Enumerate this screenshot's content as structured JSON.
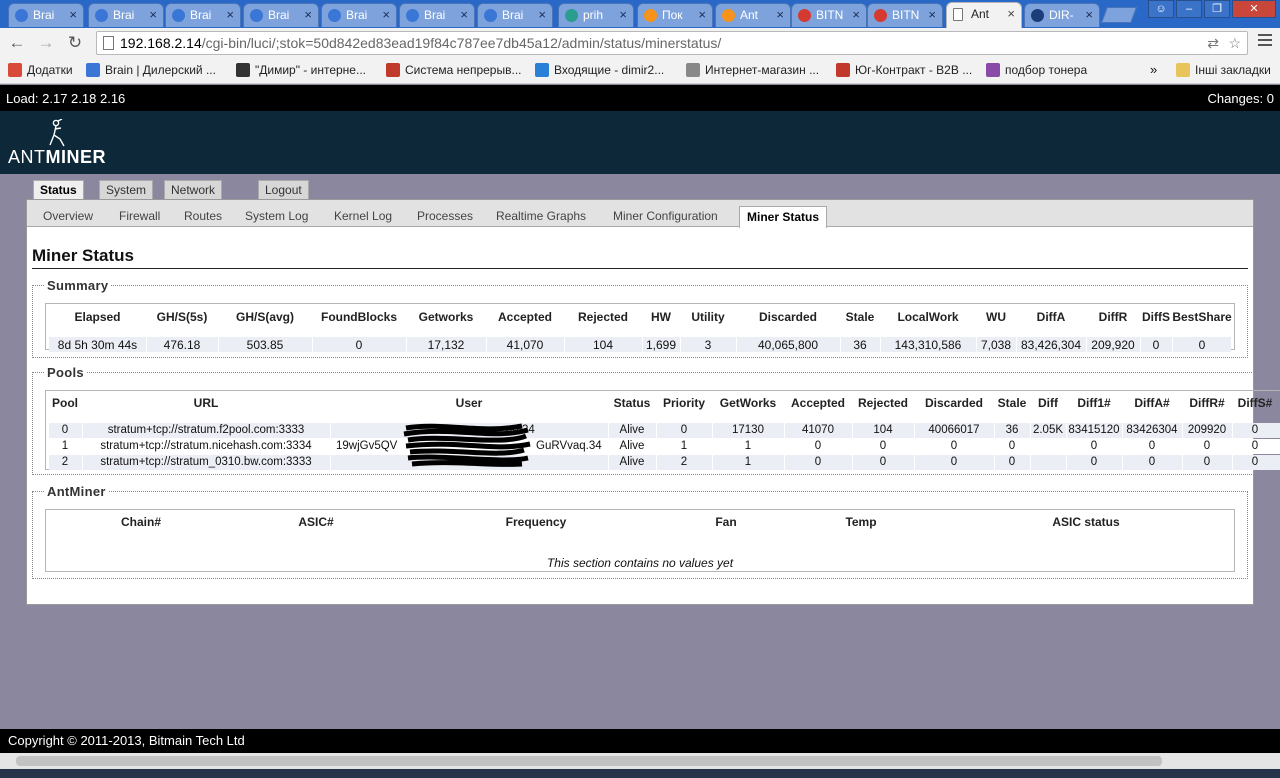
{
  "browser": {
    "tabs": [
      {
        "title": "Brai",
        "icon": "brain-icon",
        "color": "#3a76d6"
      },
      {
        "title": "Brai",
        "icon": "brain-icon",
        "color": "#3a76d6"
      },
      {
        "title": "Brai",
        "icon": "brain-icon",
        "color": "#3a76d6"
      },
      {
        "title": "Brai",
        "icon": "brain-icon",
        "color": "#3a76d6"
      },
      {
        "title": "Brai",
        "icon": "brain-icon",
        "color": "#3a76d6"
      },
      {
        "title": "Brai",
        "icon": "brain-icon",
        "color": "#3a76d6"
      },
      {
        "title": "Brai",
        "icon": "brain-icon",
        "color": "#3a76d6"
      },
      {
        "title": "prih",
        "icon": "circle-icon",
        "color": "#2a9d8f"
      },
      {
        "title": "Пок",
        "icon": "bitcoin-icon",
        "color": "#f7931a"
      },
      {
        "title": "Ant",
        "icon": "bitcoin-icon",
        "color": "#f7931a"
      },
      {
        "title": "BITN",
        "icon": "bitmain-icon",
        "color": "#d43a2f"
      },
      {
        "title": "BITN",
        "icon": "bitmain-icon",
        "color": "#d43a2f"
      },
      {
        "title": "Ant",
        "icon": "page-icon",
        "color": "#ffffff"
      },
      {
        "title": "DIR-",
        "icon": "dlink-icon",
        "color": "#1d3d7a"
      }
    ],
    "url_host": "192.168.2.14",
    "url_path": "/cgi-bin/luci/;stok=50d842ed83ead19f84c787ee7db45a12/admin/status/minerstatus/",
    "bookmarks": [
      {
        "label": "Додатки",
        "color": "#d84a3a"
      },
      {
        "label": "Brain | Дилерский ...",
        "color": "#3a76d6"
      },
      {
        "label": "\"Димир\" - интерне...",
        "color": "#333333"
      },
      {
        "label": "Система непрерыв...",
        "color": "#c0392b"
      },
      {
        "label": "Входящие - dimir2...",
        "color": "#2a7fd6"
      },
      {
        "label": "Интернет-магазин ...",
        "color": "#888888"
      },
      {
        "label": "Юг-Контракт - B2B ...",
        "color": "#c0392b"
      },
      {
        "label": "подбор тонера",
        "color": "#8a4aa8"
      }
    ],
    "more_chevron": "»",
    "other_bookmarks": "Інші закладки"
  },
  "status_bar": {
    "load": "Load: 2.17 2.18 2.16",
    "changes": "Changes: 0"
  },
  "logo": {
    "ant": "ANT",
    "miner": "MINER"
  },
  "main_tabs": [
    "Status",
    "System",
    "Network",
    "Logout"
  ],
  "sub_tabs": [
    "Overview",
    "Firewall",
    "Routes",
    "System Log",
    "Kernel Log",
    "Processes",
    "Realtime Graphs",
    "Miner Configuration",
    "Miner Status"
  ],
  "page_title": "Miner Status",
  "summary": {
    "legend": "Summary",
    "headers": [
      "Elapsed",
      "GH/S(5s)",
      "GH/S(avg)",
      "FoundBlocks",
      "Getworks",
      "Accepted",
      "Rejected",
      "HW",
      "Utility",
      "Discarded",
      "Stale",
      "LocalWork",
      "WU",
      "DiffA",
      "DiffR",
      "DiffS",
      "BestShare"
    ],
    "values": [
      "8d 5h 30m 44s",
      "476.18",
      "503.85",
      "0",
      "17,132",
      "41,070",
      "104",
      "1,699",
      "3",
      "40,065,800",
      "36",
      "143,310,586",
      "7,038",
      "83,426,304",
      "209,920",
      "0",
      "0"
    ]
  },
  "pools": {
    "legend": "Pools",
    "headers": [
      "Pool",
      "URL",
      "User",
      "Status",
      "Priority",
      "GetWorks",
      "Accepted",
      "Rejected",
      "Discarded",
      "Stale",
      "Diff",
      "Diff1#",
      "DiffA#",
      "DiffR#",
      "DiffS#"
    ],
    "rows": [
      [
        "0",
        "stratum+tcp://stratum.f2pool.com:3333",
        "ant34",
        "Alive",
        "0",
        "17130",
        "41070",
        "104",
        "40066017",
        "36",
        "2.05K",
        "83415120",
        "83426304",
        "209920",
        "0"
      ],
      [
        "1",
        "stratum+tcp://stratum.nicehash.com:3334",
        "19wjGv5QV",
        "Alive",
        "1",
        "1",
        "0",
        "0",
        "0",
        "0",
        "",
        "0",
        "0",
        "0",
        "0"
      ],
      [
        "2",
        "stratum+tcp://stratum_0310.bw.com:3333",
        "",
        "Alive",
        "2",
        "1",
        "0",
        "0",
        "0",
        "0",
        "",
        "0",
        "0",
        "0",
        "0"
      ]
    ],
    "user_suffix_1": "GuRVvaq.34"
  },
  "antminer": {
    "legend": "AntMiner",
    "headers": [
      "Chain#",
      "ASIC#",
      "Frequency",
      "Fan",
      "Temp",
      "ASIC status"
    ],
    "empty_text": "This section contains no values yet"
  },
  "footer": "Copyright © 2011-2013, Bitmain Tech Ltd"
}
